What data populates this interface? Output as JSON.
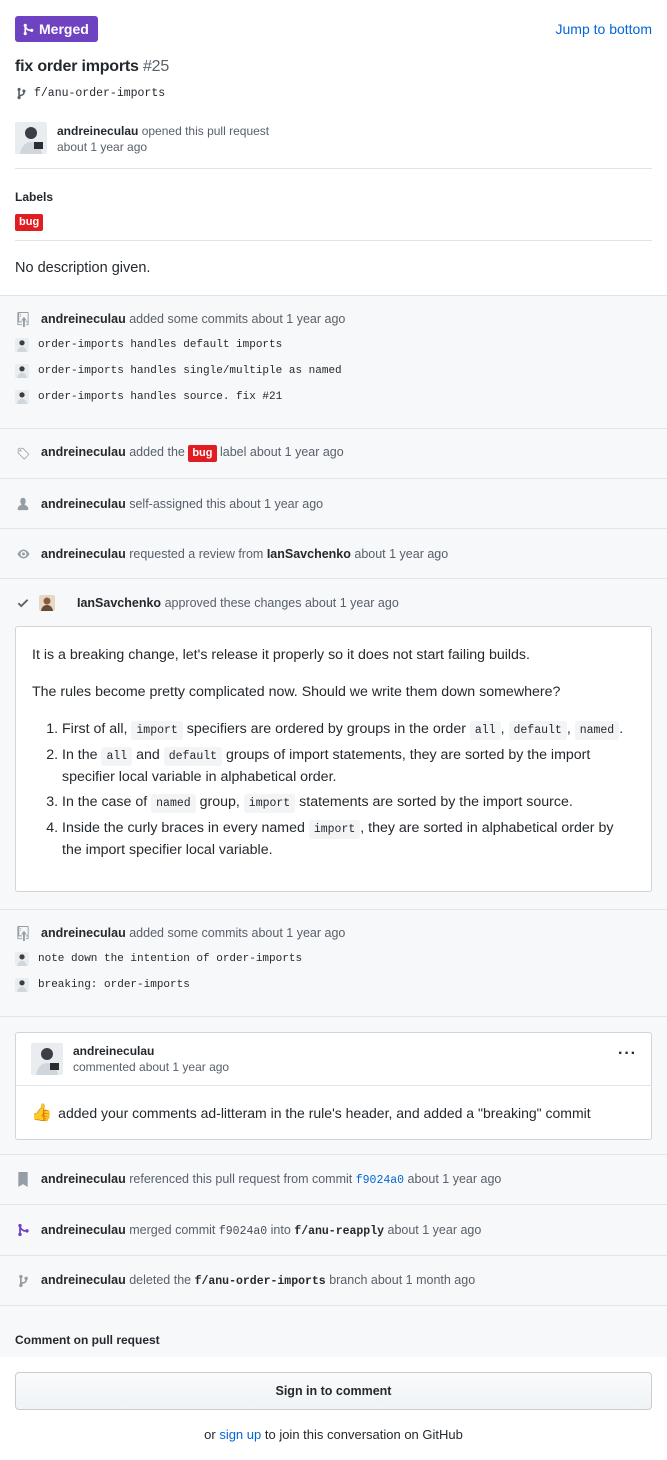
{
  "header": {
    "status_badge": "Merged",
    "jump_link": "Jump to bottom",
    "title": "fix order imports",
    "number": "#25",
    "branch": "f/anu-order-imports",
    "opener_user": "andreineculau",
    "opener_action": "opened this pull request",
    "opener_time": "about 1 year ago"
  },
  "labels": {
    "heading": "Labels",
    "items": [
      "bug"
    ]
  },
  "description": "No description given.",
  "timeline": {
    "commits1": {
      "user": "andreineculau",
      "action": "added some commits",
      "time": "about 1 year ago",
      "items": [
        "order-imports handles default imports",
        "order-imports handles single/multiple as named",
        "order-imports handles source. fix #21"
      ]
    },
    "label_event": {
      "user": "andreineculau",
      "pre": "added the",
      "label": "bug",
      "post": "label",
      "time": "about 1 year ago"
    },
    "assign_event": {
      "user": "andreineculau",
      "action": "self-assigned this",
      "time": "about 1 year ago"
    },
    "review_request": {
      "user": "andreineculau",
      "action": "requested a review from",
      "target": "IanSavchenko",
      "time": "about 1 year ago"
    },
    "approval": {
      "user": "IanSavchenko",
      "action": "approved these changes",
      "time": "about 1 year ago",
      "p1": "It is a breaking change, let's release it properly so it does not start failing builds.",
      "p2": "The rules become pretty complicated now. Should we write them down somewhere?",
      "li1": {
        "a": "First of all,",
        "c1": "import",
        "b": "specifiers are ordered by groups in the order",
        "c2": "all",
        "c3": "default",
        "c4": "named"
      },
      "li2": {
        "a": "In the",
        "c1": "all",
        "b": "and",
        "c2": "default",
        "c": "groups of import statements, they are sorted by the import specifier local variable in alphabetical order."
      },
      "li3": {
        "a": "In the case of",
        "c1": "named",
        "b": "group,",
        "c2": "import",
        "c": "statements are sorted by the import source."
      },
      "li4": {
        "a": "Inside the curly braces in every named",
        "c1": "import",
        "b": ", they are sorted in alphabetical order by the import specifier local variable."
      }
    },
    "commits2": {
      "user": "andreineculau",
      "action": "added some commits",
      "time": "about 1 year ago",
      "items": [
        "note down the intention of order-imports",
        "breaking: order-imports"
      ]
    },
    "comment": {
      "user": "andreineculau",
      "meta": "commented about 1 year ago",
      "menu": "···",
      "emoji": "👍",
      "body": "added your comments ad-litteram in the rule's header, and added a \"breaking\" commit"
    },
    "reference": {
      "user": "andreineculau",
      "action": "referenced this pull request from commit",
      "commit": "f9024a0",
      "time": "about 1 year ago"
    },
    "merge": {
      "user": "andreineculau",
      "pre": "merged commit",
      "commit": "f9024a0",
      "mid": "into",
      "branch": "f/anu-reapply",
      "time": "about 1 year ago"
    },
    "delete": {
      "user": "andreineculau",
      "pre": "deleted the",
      "branch": "f/anu-order-imports",
      "post": "branch",
      "time": "about 1 month ago"
    }
  },
  "footer": {
    "heading": "Comment on pull request",
    "signin": "Sign in to comment",
    "or": "or",
    "signup": "sign up",
    "rest": "to join this conversation on GitHub"
  },
  "colors": {
    "merged": "#6f42c1",
    "bug": "#e11d21",
    "link": "#0366d6"
  }
}
